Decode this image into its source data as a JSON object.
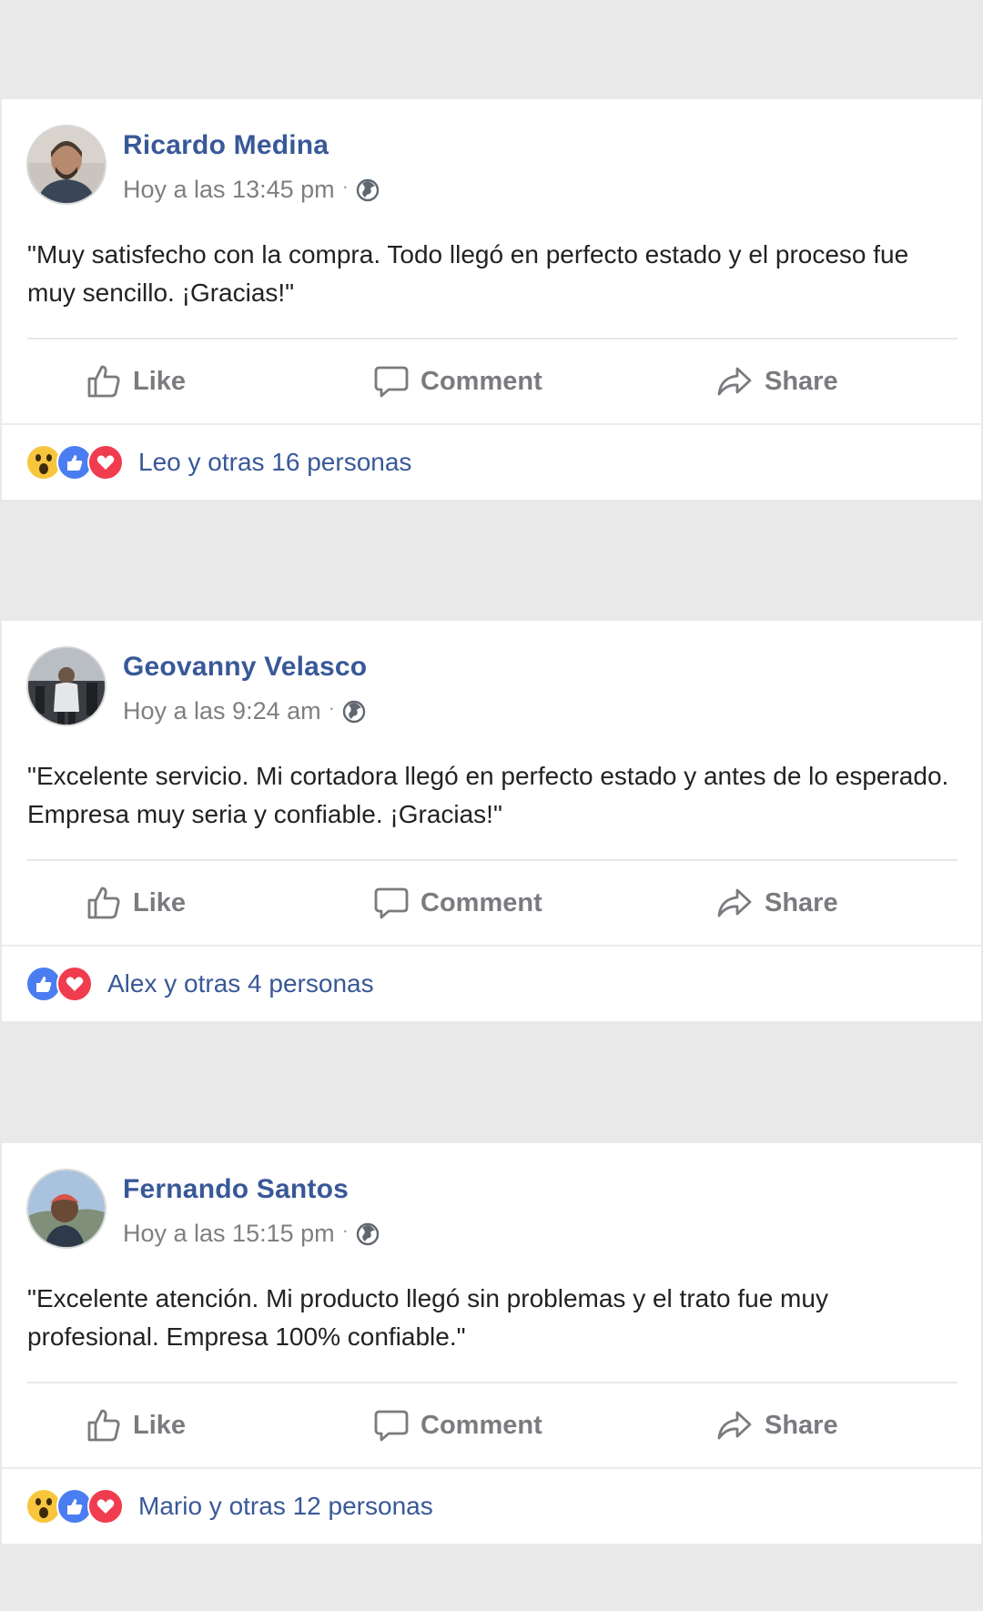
{
  "posts": [
    {
      "author": "Ricardo Medina",
      "timestamp": "Hoy a las 13:45 pm",
      "text": "\"Muy satisfecho con la compra. Todo llegó en perfecto estado y el proceso fue muy sencillo. ¡Gracias!\"",
      "reactions": [
        "wow",
        "like",
        "love"
      ],
      "reaction_text": "Leo y otras 16 personas"
    },
    {
      "author": "Geovanny Velasco",
      "timestamp": "Hoy a las 9:24 am",
      "text": "\"Excelente servicio. Mi cortadora llegó en perfecto estado y antes de lo esperado. Empresa muy seria y confiable. ¡Gracias!\"",
      "reactions": [
        "like",
        "love"
      ],
      "reaction_text": "Alex y otras 4 personas"
    },
    {
      "author": "Fernando Santos",
      "timestamp": "Hoy a las 15:15 pm",
      "text": "\"Excelente atención. Mi producto llegó sin problemas y el trato fue muy profesional. Empresa 100% confiable.\"",
      "reactions": [
        "wow",
        "like",
        "love"
      ],
      "reaction_text": "Mario y otras 12 personas"
    }
  ],
  "actions": {
    "like": "Like",
    "comment": "Comment",
    "share": "Share"
  },
  "colors": {
    "author": "#385898",
    "action": "#7a7b7f",
    "background": "#e9e9ea",
    "like": "#4a7df1",
    "love": "#f03c4e",
    "wow": "#f7c63d"
  },
  "icons": [
    "globe-icon",
    "thumbs-up-icon",
    "comment-bubble-icon",
    "share-arrow-icon",
    "wow-reaction-icon",
    "like-reaction-icon",
    "love-reaction-icon"
  ]
}
